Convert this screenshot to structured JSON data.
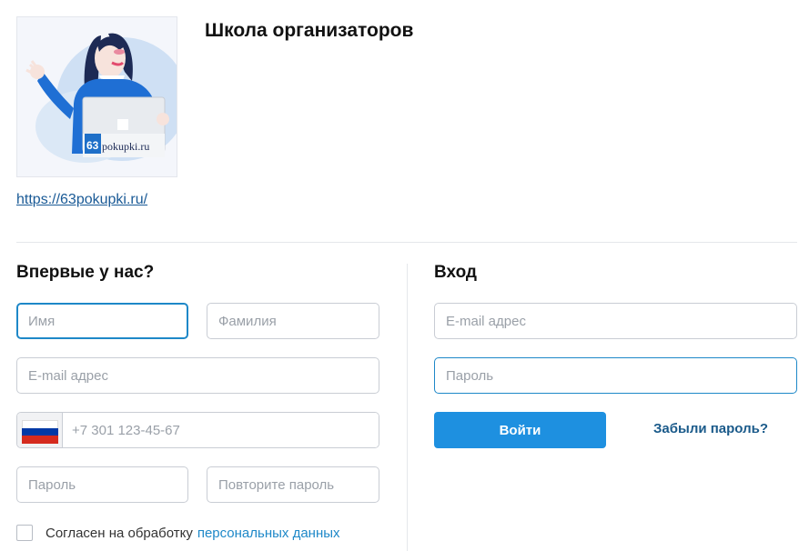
{
  "header": {
    "title": "Школа организаторов",
    "logo_text": "pokupki.ru",
    "logo_number": "63",
    "site_url": "https://63pokupki.ru/"
  },
  "register": {
    "title": "Впервые у нас?",
    "first_name_placeholder": "Имя",
    "last_name_placeholder": "Фамилия",
    "email_placeholder": "E-mail адрес",
    "phone_placeholder": "+7 301 123-45-67",
    "password_placeholder": "Пароль",
    "repeat_password_placeholder": "Повторите пароль",
    "consent_text": "Согласен на обработку",
    "consent_link": "персональных данных",
    "country_flag": "flag-russia-icon"
  },
  "login": {
    "title": "Вход",
    "email_placeholder": "E-mail адрес",
    "password_placeholder": "Пароль",
    "submit_label": "Войти",
    "forgot_label": "Забыли пароль?"
  },
  "colors": {
    "accent": "#1e90e0",
    "link": "#1a5a96",
    "focus_border": "#1e88c8"
  }
}
